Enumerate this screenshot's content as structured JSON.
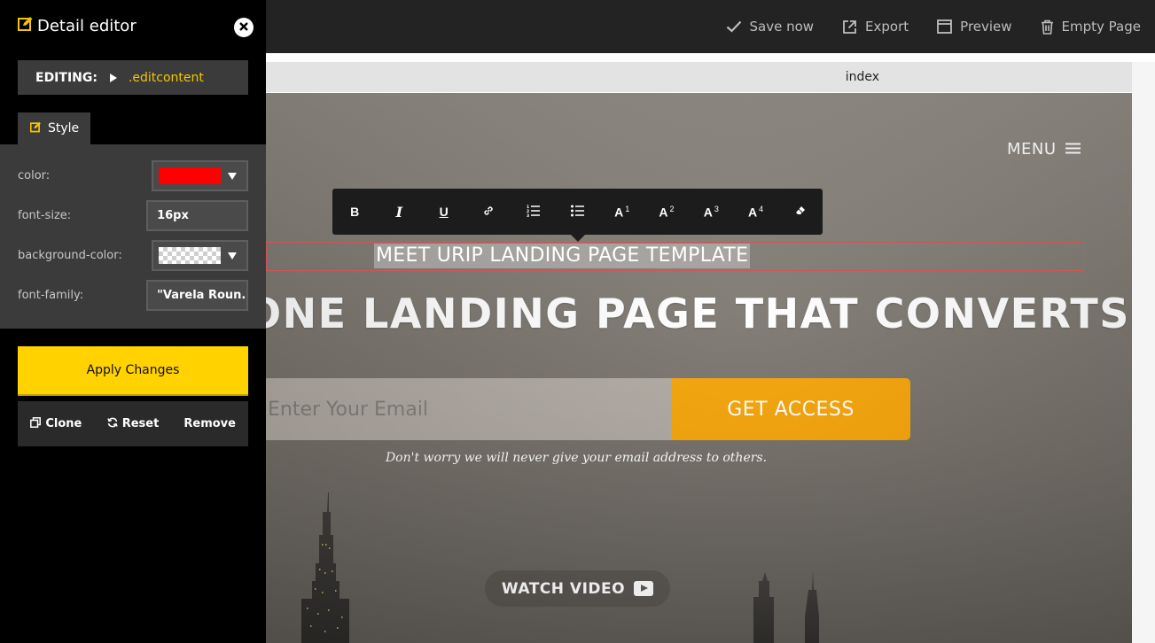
{
  "topbar": {
    "actions": [
      {
        "label": "Save now",
        "icon": "check-icon"
      },
      {
        "label": "Export",
        "icon": "export-icon"
      },
      {
        "label": "Preview",
        "icon": "preview-icon"
      },
      {
        "label": "Empty Page",
        "icon": "trash-icon"
      }
    ]
  },
  "canvas": {
    "tab_title": "index"
  },
  "hero": {
    "menu_label": "MENU",
    "subheading": "MEET URIP LANDING PAGE TEMPLATE",
    "headline": "ONE LANDING PAGE THAT CONVERTS",
    "email_placeholder": "Enter Your Email",
    "cta_label": "GET ACCESS",
    "disclaimer": "Don't worry we will never give your email address to others.",
    "watch_video_label": "WATCH VIDEO"
  },
  "toolbar": {
    "buttons": [
      {
        "label": "B",
        "icon": "bold-icon"
      },
      {
        "label": "I",
        "icon": "italic-icon"
      },
      {
        "label": "U",
        "icon": "underline-icon"
      },
      {
        "label": "",
        "icon": "link-icon"
      },
      {
        "label": "",
        "icon": "ordered-list-icon"
      },
      {
        "label": "",
        "icon": "unordered-list-icon"
      },
      {
        "label": "A",
        "sup": "1",
        "icon": "heading-1-icon"
      },
      {
        "label": "A",
        "sup": "2",
        "icon": "heading-2-icon"
      },
      {
        "label": "A",
        "sup": "3",
        "icon": "heading-3-icon"
      },
      {
        "label": "A",
        "sup": "4",
        "icon": "heading-4-icon"
      },
      {
        "label": "",
        "icon": "eraser-icon"
      }
    ]
  },
  "editor": {
    "title": "Detail editor",
    "editing_label": "EDITING:",
    "editing_target": ".editcontent",
    "style_tab": "Style",
    "properties": {
      "color": {
        "label": "color:",
        "value": "#ff0000"
      },
      "font_size": {
        "label": "font-size:",
        "value": "16px"
      },
      "background_color": {
        "label": "background-color:",
        "value": "transparent"
      },
      "font_family": {
        "label": "font-family:",
        "value": "\"Varela Roun.."
      }
    },
    "apply_label": "Apply Changes",
    "actions": {
      "clone": "Clone",
      "reset": "Reset",
      "remove": "Remove"
    }
  },
  "colors": {
    "accent_yellow": "#ffd200",
    "cta_orange": "#f5a100",
    "panel_bg": "#000000",
    "topbar_bg": "#232323"
  }
}
